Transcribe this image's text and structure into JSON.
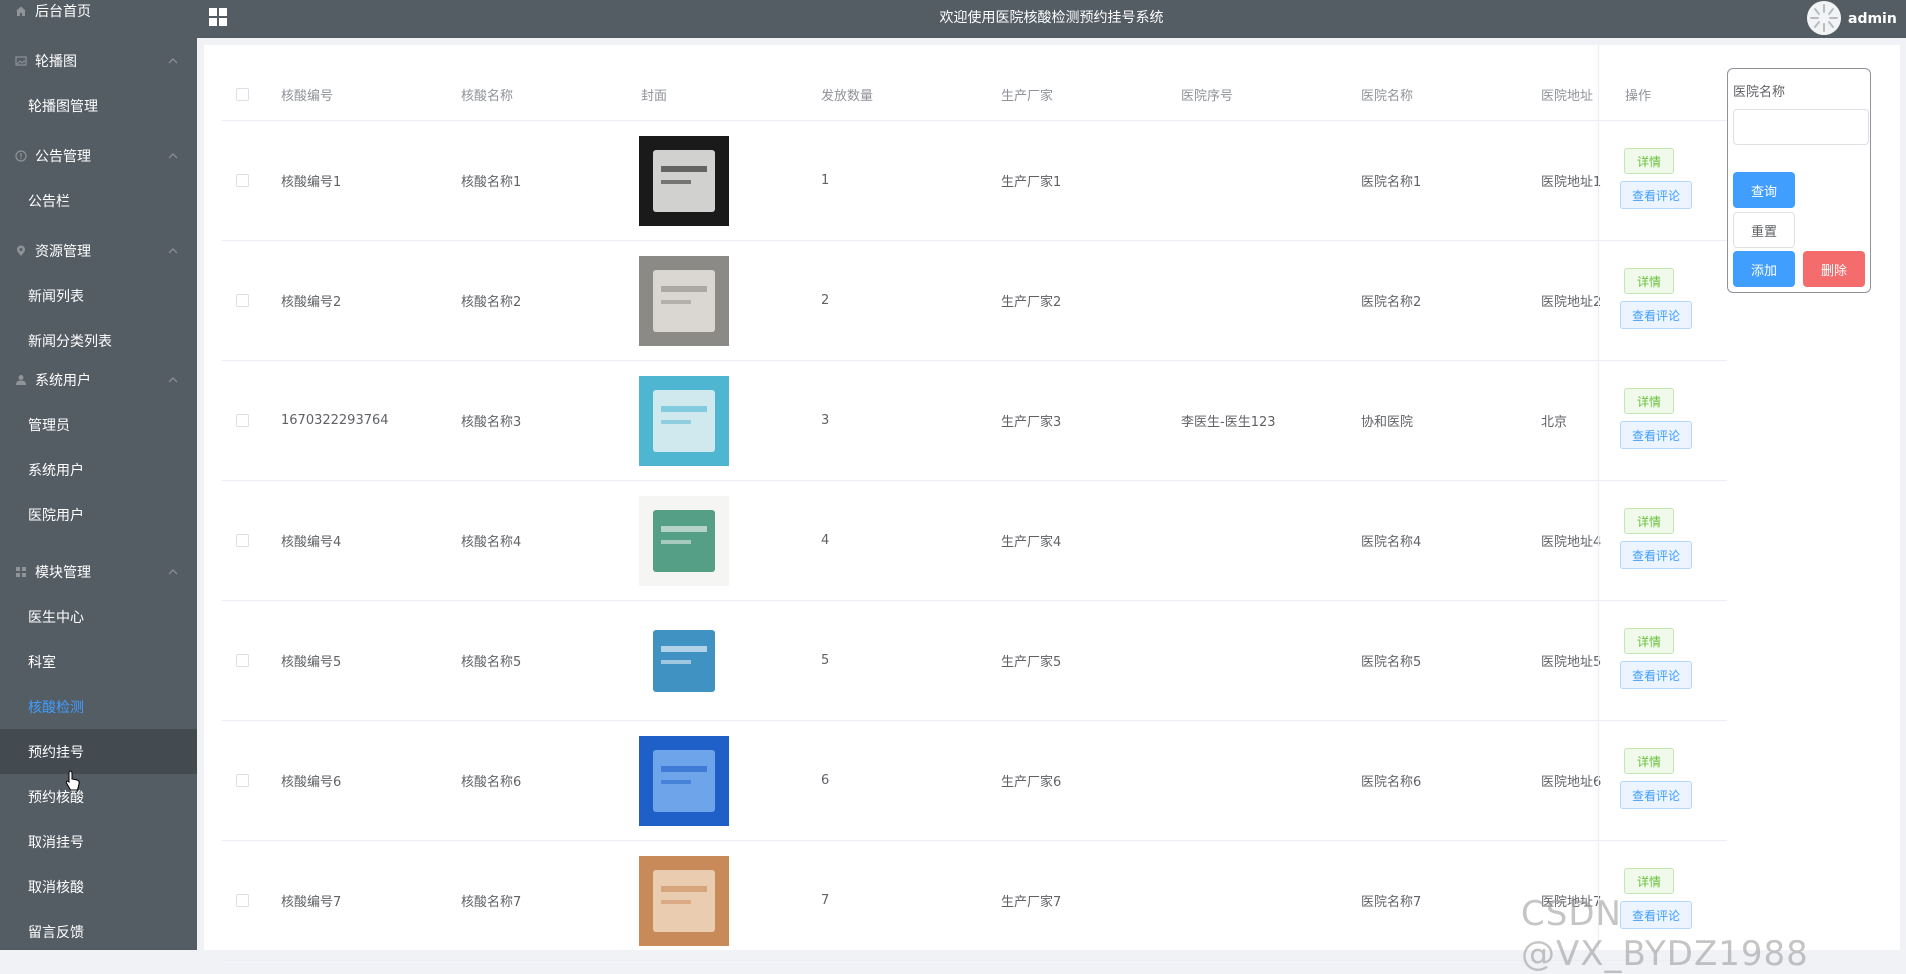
{
  "header": {
    "title": "欢迎使用医院核酸检测预约挂号系统",
    "username": "admin"
  },
  "sidebar": {
    "top_item": "后台首页",
    "groups": [
      {
        "label": "轮播图",
        "icon": "image-icon",
        "items": [
          "轮播图管理"
        ]
      },
      {
        "label": "公告管理",
        "icon": "info-icon",
        "items": [
          "公告栏"
        ]
      },
      {
        "label": "资源管理",
        "icon": "location-icon",
        "items": [
          "新闻列表",
          "新闻分类列表"
        ]
      },
      {
        "label": "系统用户",
        "icon": "user-icon",
        "items": [
          "管理员",
          "系统用户",
          "医院用户"
        ]
      },
      {
        "label": "模块管理",
        "icon": "grid-icon",
        "items": [
          "医生中心",
          "科室",
          "核酸检测",
          "预约挂号",
          "预约核酸",
          "取消挂号",
          "取消核酸",
          "留言反馈"
        ]
      }
    ],
    "active_item": "核酸检测",
    "hover_item": "预约挂号"
  },
  "table": {
    "columns": [
      "核酸编号",
      "核酸名称",
      "封面",
      "发放数量",
      "生产厂家",
      "医院序号",
      "医院名称",
      "医院地址",
      "操作"
    ],
    "rows": [
      {
        "code": "核酸编号1",
        "name": "核酸名称1",
        "qty": "1",
        "maker": "生产厂家1",
        "hospital_no": "",
        "hospital_name": "医院名称1",
        "address": "医院地址1",
        "cover_color": "#1a1a1a",
        "cover_accent": "#f2f2f0"
      },
      {
        "code": "核酸编号2",
        "name": "核酸名称2",
        "qty": "2",
        "maker": "生产厂家2",
        "hospital_no": "",
        "hospital_name": "医院名称2",
        "address": "医院地址2",
        "cover_color": "#8c8a87",
        "cover_accent": "#e8e4df"
      },
      {
        "code": "1670322293764",
        "name": "核酸名称3",
        "qty": "3",
        "maker": "生产厂家3",
        "hospital_no": "李医生-医生123",
        "hospital_name": "协和医院",
        "address": "北京",
        "cover_color": "#4fb6d2",
        "cover_accent": "#e6f2f5"
      },
      {
        "code": "核酸编号4",
        "name": "核酸名称4",
        "qty": "4",
        "maker": "生产厂家4",
        "hospital_no": "",
        "hospital_name": "医院名称4",
        "address": "医院地址4",
        "cover_color": "#f5f6f4",
        "cover_accent": "#3a8f73"
      },
      {
        "code": "核酸编号5",
        "name": "核酸名称5",
        "qty": "5",
        "maker": "生产厂家5",
        "hospital_no": "",
        "hospital_name": "医院名称5",
        "address": "医院地址5",
        "cover_color": "#ffffff",
        "cover_accent": "#1f7fb8"
      },
      {
        "code": "核酸编号6",
        "name": "核酸名称6",
        "qty": "6",
        "maker": "生产厂家6",
        "hospital_no": "",
        "hospital_name": "医院名称6",
        "address": "医院地址6",
        "cover_color": "#1f5fc8",
        "cover_accent": "#7db0f0"
      },
      {
        "code": "核酸编号7",
        "name": "核酸名称7",
        "qty": "7",
        "maker": "生产厂家7",
        "hospital_no": "",
        "hospital_name": "医院名称7",
        "address": "医院地址7",
        "cover_color": "#c98a5a",
        "cover_accent": "#f0d8c0"
      }
    ],
    "detail_label": "详情",
    "review_label": "查看评论"
  },
  "search": {
    "label": "医院名称",
    "input_value": "",
    "query_label": "查询",
    "reset_label": "重置",
    "add_label": "添加",
    "delete_label": "删除"
  },
  "watermark": "CSDN @VX_BYDZ1988",
  "colors": {
    "sidebar_bg": "#545c64",
    "active_text": "#409eff",
    "primary": "#409eff",
    "danger": "#f56c6c",
    "success": "#67c23a"
  }
}
